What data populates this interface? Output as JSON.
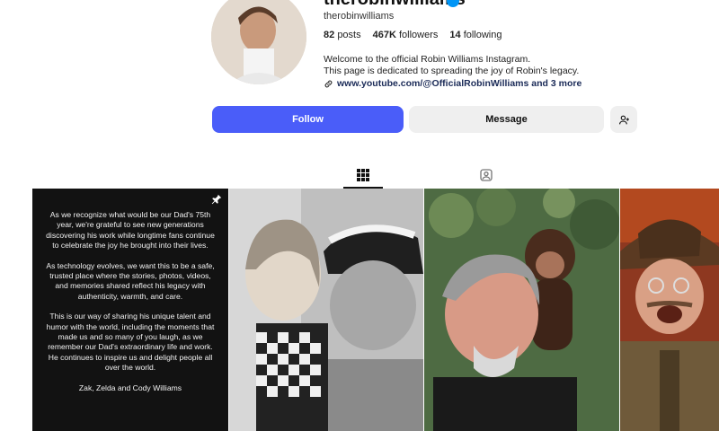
{
  "profile": {
    "display_name": "therobinwilliams",
    "handle": "therobinwilliams",
    "stats": {
      "posts_count": "82",
      "posts_label": "posts",
      "followers_count": "467K",
      "followers_label": "followers",
      "following_count": "14",
      "following_label": "following"
    },
    "bio": [
      "Welcome to the official Robin Williams Instagram.",
      "This page is dedicated to spreading the joy of Robin's legacy."
    ],
    "link_text": "www.youtube.com/@OfficialRobinWilliams and 3 more"
  },
  "actions": {
    "follow_label": "Follow",
    "message_label": "Message"
  },
  "tabs": [
    "posts-grid",
    "tagged"
  ],
  "posts": {
    "pinned_post": {
      "paragraphs": [
        "As we recognize what would be our Dad's 75th year, we're grateful to see new generations discovering his work while longtime fans continue to celebrate the joy he brought into their lives.",
        "As technology evolves, we want this to be a safe, trusted place where the stories, photos, videos, and memories shared reflect his legacy with authenticity, warmth, and care.",
        "This is our way of sharing his unique talent and humor with the world, including the moments that made us and so many of you laugh, as we remember our Dad's extraordinary life and work. He continues to inspire us and delight people all over the world.",
        "Zak, Zelda and Cody Williams"
      ]
    }
  },
  "colors": {
    "follow_button": "#4a5df9",
    "secondary_button": "#efefef",
    "verified_badge": "#0095f6"
  },
  "icons": [
    "verified-badge-icon",
    "link-icon",
    "add-person-icon",
    "grid-icon",
    "tagged-icon",
    "pin-icon"
  ]
}
